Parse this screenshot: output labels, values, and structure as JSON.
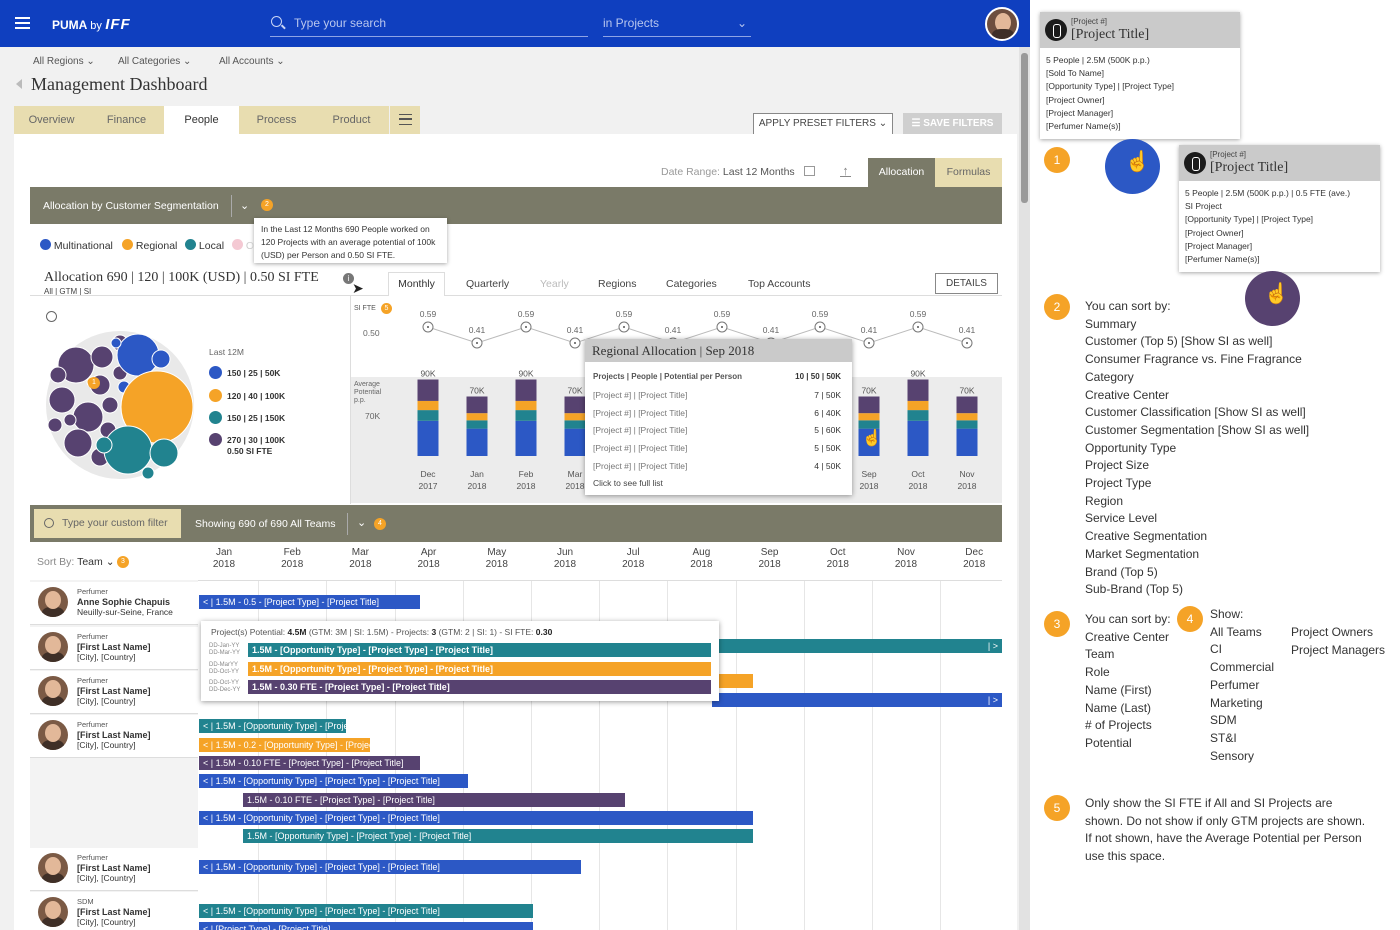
{
  "header": {
    "brand": "PUMA",
    "brand_by": "by",
    "brand_iff": "IFF",
    "search_placeholder": "Type your search",
    "scope": "in Projects"
  },
  "filters": [
    "All Regions",
    "All Categories",
    "All Accounts"
  ],
  "page_title": "Management Dashboard",
  "tabs": [
    "Overview",
    "Finance",
    "People",
    "Process",
    "Product"
  ],
  "buttons": {
    "apply_preset": "APPLY PRESET FILTERS",
    "save_filters": "SAVE FILTERS",
    "details": "DETAILS"
  },
  "date_range": {
    "label": "Date Range:",
    "value": "Last 12 Months"
  },
  "view_tabs": [
    "Allocation",
    "Formulas"
  ],
  "alloc_panel": {
    "title": "Allocation by Customer Segmentation",
    "badge": "2",
    "tooltip": "In the Last 12 Months 690 People worked on 120 Projects with an average potential of 100k (USD) per Person and 0.50 SI FTE."
  },
  "legend": [
    "Multinational",
    "Regional",
    "Local",
    "O"
  ],
  "summary": {
    "title": "Allocation 690 | 120 | 100K (USD) | 0.50 SI FTE",
    "sub": "All | GTM | SI"
  },
  "period_tabs": [
    "Monthly",
    "Quarterly",
    "Yearly",
    "Regions",
    "Categories",
    "Top Accounts"
  ],
  "bubble_legend": {
    "title": "Last 12M",
    "items": [
      "150 | 25 | 50K",
      "120 | 40 | 100K",
      "150 | 25 | 150K",
      "270 | 30 | 100K",
      "0.50 SI FTE"
    ],
    "badge": "1"
  },
  "chart_labels": {
    "si_fte": "SI FTE",
    "si_badge": "5",
    "si_axis": "0.50",
    "avg_label": "Average Potential p.p.",
    "avg_axis": "70K"
  },
  "chart_data": {
    "type": "bar",
    "categories": [
      "Dec 2017",
      "Jan 2018",
      "Feb 2018",
      "Mar 2018",
      "Apr 2018",
      "May 2018",
      "Jun 2018",
      "Jul 2018",
      "Aug 2018",
      "Sep 2018",
      "Oct 2018",
      "Nov 2018"
    ],
    "x_lines": [
      [
        "Dec",
        "2017"
      ],
      [
        "Jan",
        "2018"
      ],
      [
        "Feb",
        "2018"
      ],
      [
        "Mar",
        "2018"
      ],
      [
        "Apr",
        "2018"
      ],
      [
        "May",
        "2018"
      ],
      [
        "Jun",
        "2018"
      ],
      [
        "Jul",
        "2018"
      ],
      [
        "Aug",
        "2018"
      ],
      [
        "Sep",
        "2018"
      ],
      [
        "Oct",
        "2018"
      ],
      [
        "Nov",
        "2018"
      ]
    ],
    "bar_labels": [
      "90K",
      "70K",
      "90K",
      "70K",
      "90K",
      "70K",
      "90K",
      "70K",
      "90K",
      "70K",
      "90K",
      "70K"
    ],
    "si_fte": [
      0.59,
      0.41,
      0.59,
      0.41,
      0.59,
      0.41,
      0.59,
      0.41,
      0.59,
      0.41,
      0.59,
      0.41
    ],
    "si_labels": [
      "0.59",
      "0.41",
      "0.59",
      "0.41",
      "0.59",
      "0.41",
      "0.59",
      "0.41",
      "0.59",
      "0.41",
      "0.59",
      "0.41"
    ],
    "series": [
      {
        "name": "",
        "values": [
          90,
          70,
          90,
          70,
          90,
          70,
          90,
          70,
          90,
          70,
          90,
          70
        ]
      }
    ],
    "colors": [
      "#574270",
      "#f5a327",
      "#21838f",
      "#2c58c5"
    ]
  },
  "regional_popup": {
    "title": "Regional Allocation | Sep 2018",
    "head_left": "Projects | People | Potential per Person",
    "head_right": "10 | 50 | 50K",
    "rows": [
      {
        "l": "[Project #] | [Project Title]",
        "r": "7 | 50K"
      },
      {
        "l": "[Project #] | [Project Title]",
        "r": "6 | 40K"
      },
      {
        "l": "[Project #] | [Project Title]",
        "r": "5 | 60K"
      },
      {
        "l": "[Project #] | [Project Title]",
        "r": "5 | 50K"
      },
      {
        "l": "[Project #] | [Project Title]",
        "r": "4 | 50K"
      }
    ],
    "footer": "Click to see full list"
  },
  "teams_bar": {
    "filter_placeholder": "Type your custom filter",
    "showing": "Showing 690 of 690 All Teams",
    "badge": "4"
  },
  "sort": {
    "label": "Sort By:",
    "value": "Team",
    "badge": "3"
  },
  "months": [
    [
      "Jan",
      "2018"
    ],
    [
      "Feb",
      "2018"
    ],
    [
      "Mar",
      "2018"
    ],
    [
      "Apr",
      "2018"
    ],
    [
      "May",
      "2018"
    ],
    [
      "Jun",
      "2018"
    ],
    [
      "Jul",
      "2018"
    ],
    [
      "Aug",
      "2018"
    ],
    [
      "Sep",
      "2018"
    ],
    [
      "Oct",
      "2018"
    ],
    [
      "Nov",
      "2018"
    ],
    [
      "Dec",
      "2018"
    ]
  ],
  "people": [
    {
      "role": "Perfumer",
      "name": "Anne Sophie Chapuis",
      "loc": "Neuilly-sur-Seine, France"
    },
    {
      "role": "Perfumer",
      "name": "[First Last Name]",
      "loc": "[City], [Country]"
    },
    {
      "role": "Perfumer",
      "name": "[First Last Name]",
      "loc": "[City], [Country]"
    },
    {
      "role": "Perfumer",
      "name": "[First Last Name]",
      "loc": "[City], [Country]"
    },
    {
      "role": "Perfumer",
      "name": "[First Last Name]",
      "loc": "[City], [Country]"
    },
    {
      "role": "SDM",
      "name": "[First Last Name]",
      "loc": "[City], [Country]"
    }
  ],
  "gantt": [
    "< | 1.5M - 0.5 - [Project Type] - [Project Title]",
    "",
    "",
    "",
    "< | 1.5M - [Opportunity Type] - [Projec",
    "< | 1.5M - 0.2 - [Opportunity Type] - [Project",
    "< | 1.5M - 0.10 FTE - [Project Type] - [Project Title]",
    "< | 1.5M - [Opportunity Type] - [Project Type] - [Project Title]",
    "1.5M - 0.10 FTE - [Project Type] - [Project Title]",
    "< | 1.5M - [Opportunity Type] - [Project Type] - [Project Title]",
    "1.5M - [Opportunity Type] - [Project Type] - [Project Title]",
    "< | 1.5M - [Opportunity Type] - [Project Type] - [Project Title]",
    "< | 1.5M - [Opportunity Type] - [Project Type] - [Project Title]",
    "< | [Project Type] - [Project Title]",
    "| >"
  ],
  "potential_popup": {
    "head_a": "Project(s) Potential:",
    "head_b": "4.5M",
    "head_c": "(GTM: 3M | SI: 1.5M) - Projects:",
    "head_d": "3",
    "head_e": "(GTM: 2 | SI: 1) - SI FTE:",
    "head_f": "0.30",
    "rows": [
      {
        "d1": "DD-Jan-YY",
        "d2": "DD-Mar-YY",
        "t": "1.5M - [Opportunity Type] - [Project Type] - [Project Title]"
      },
      {
        "d1": "DD-MarYY",
        "d2": "DD-Oct-YY",
        "t": "1.5M - [Opportunity Type] - [Project Type] - [Project Title]"
      },
      {
        "d1": "DD-Oct-YY",
        "d2": "DD-Dec-YY",
        "t": "1.5M - 0.30 FTE - [Project Type] - [Project Title]"
      }
    ]
  },
  "cards": [
    {
      "num": "[Project #]",
      "title": "[Project Title]",
      "lines": [
        "5 People | 2.5M (500K p.p.)",
        "[Sold To Name]",
        "[Opportunity Type] | [Project Type]",
        "[Project Owner]",
        "[Project Manager]",
        "[Perfumer Name(s)]"
      ]
    },
    {
      "num": "[Project #]",
      "title": "[Project Title]",
      "lines": [
        "5 People | 2.5M (500K p.p.) | 0.5 FTE (ave.)",
        "SI Project",
        "[Opportunity Type] | [Project Type]",
        "[Project Owner]",
        "[Project Manager]",
        "[Perfumer Name(s)]"
      ]
    }
  ],
  "notes": {
    "n1": "1",
    "n2": "2",
    "n3": "3",
    "n4": "4",
    "n5": "5",
    "sort1_title": "You can sort by:",
    "sort1": [
      "Summary",
      "Customer (Top 5)  [Show SI as well]",
      "Consumer Fragrance vs. Fine Fragrance",
      "Category",
      "Creative Center",
      "Customer Classification [Show SI as well]",
      "Customer Segmentation [Show SI as well]",
      "Opportunity Type",
      "Project Size",
      "Project Type",
      "Region",
      "Service Level",
      "Creative Segmentation",
      "Market Segmentation",
      "Brand (Top 5)",
      "Sub-Brand (Top 5)"
    ],
    "sort3_title": "You can sort by:",
    "sort3": [
      "Creative Center",
      "Team",
      "Role",
      "Name (First)",
      "Name (Last)",
      "# of Projects",
      "Potential"
    ],
    "show_title": "Show:",
    "show_a": [
      "All Teams",
      "CI",
      "Commercial",
      "Perfumer",
      "Marketing",
      "SDM",
      "ST&I",
      "Sensory"
    ],
    "show_b": [
      "Project Owners",
      "Project Managers"
    ],
    "note5": [
      "Only show the SI FTE if All and SI Projects are",
      "shown. Do not show if only GTM projects are shown.",
      "If not shown, have the Average Potential per Person",
      "use this space."
    ]
  }
}
